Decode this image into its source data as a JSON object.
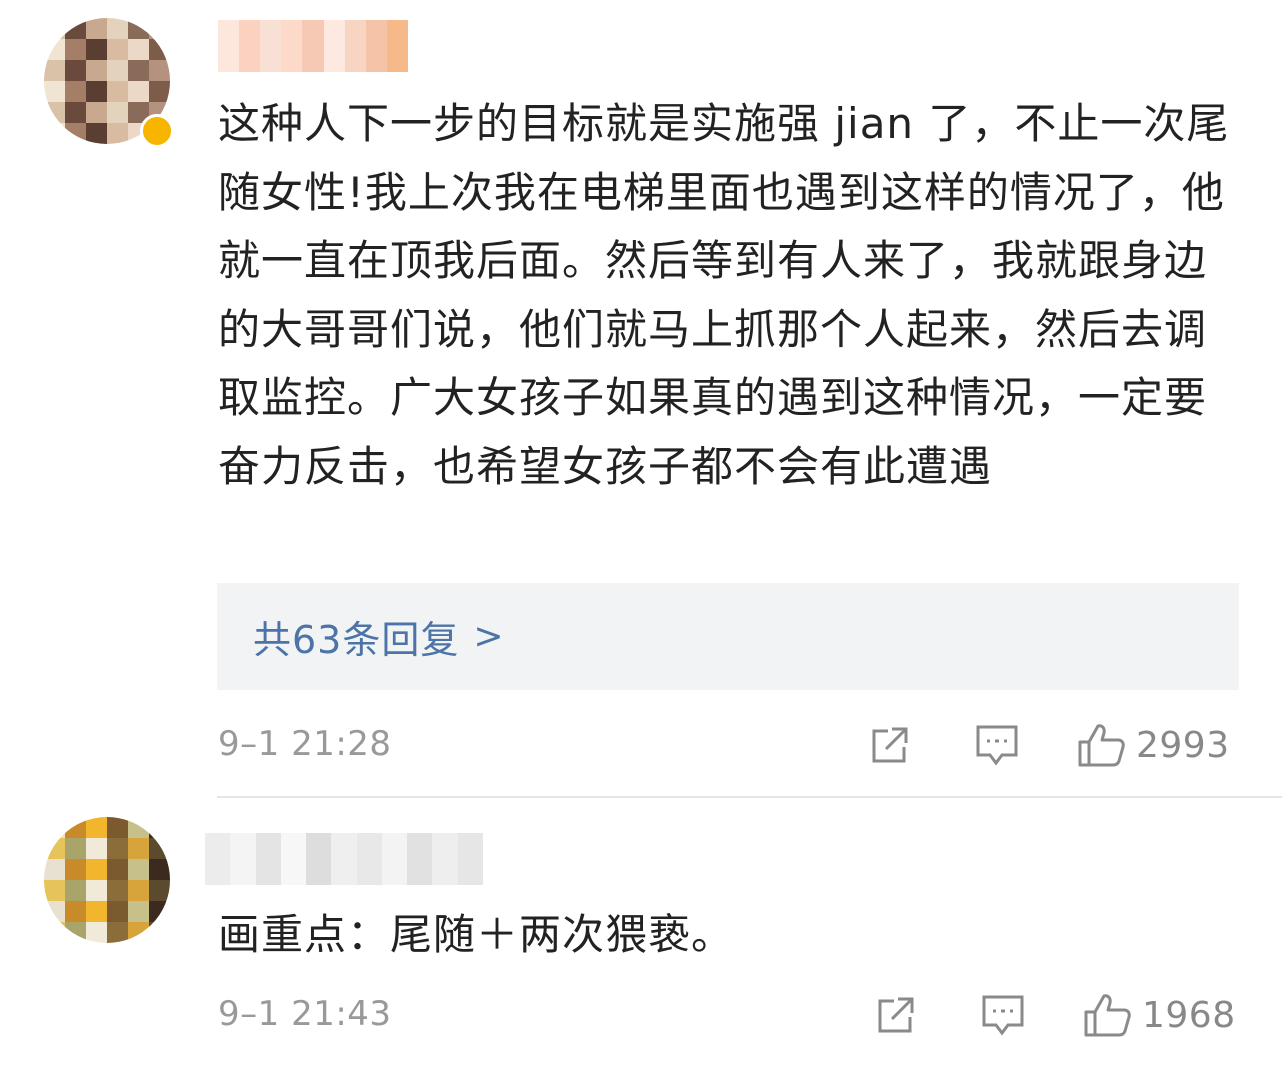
{
  "comments": [
    {
      "text": "这种人下一步的目标就是实施强 jian 了，不止一次尾随女性!我上次我在电梯里面也遇到这样的情况了，他就一直在顶我后面。然后等到有人来了，我就跟身边的大哥哥们说，他们就马上抓那个人起来，然后去调取监控。广大女孩子如果真的遇到这种情况，一定要奋力反击，也希望女孩子都不会有此遭遇",
      "replies_label": "共63条回复",
      "replies_chevron": ">",
      "time": "9–1 21:28",
      "likes": "2993"
    },
    {
      "text": "画重点：尾随＋两次猥亵。",
      "time": "9–1 21:43",
      "likes": "1968"
    }
  ],
  "colors": {
    "link": "#4d74a6",
    "meta": "#999999",
    "reply_bg": "#f2f3f5",
    "verified_badge": "#f7b500"
  },
  "icons": [
    "share-icon",
    "comment-icon",
    "thumbs-up-icon"
  ]
}
